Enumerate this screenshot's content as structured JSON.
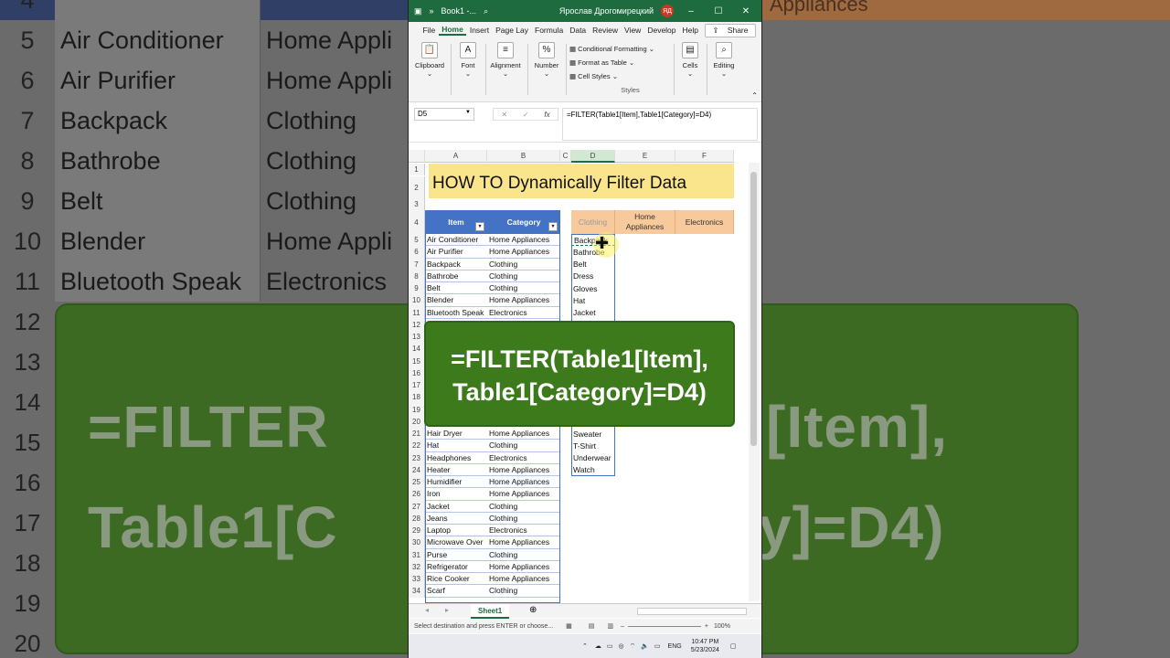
{
  "background": {
    "left_rows": [
      {
        "n": "4",
        "a": "",
        "b": ""
      },
      {
        "n": "5",
        "a": "Air Conditioner",
        "b": "Home Appli"
      },
      {
        "n": "6",
        "a": "Air Purifier",
        "b": "Home Appli"
      },
      {
        "n": "7",
        "a": "Backpack",
        "b": "Clothing"
      },
      {
        "n": "8",
        "a": "Bathrobe",
        "b": "Clothing"
      },
      {
        "n": "9",
        "a": "Belt",
        "b": "Clothing"
      },
      {
        "n": "10",
        "a": "Blender",
        "b": "Home Appli"
      },
      {
        "n": "11",
        "a": "Bluetooth Speak",
        "b": "Electronics"
      }
    ],
    "left_nums": [
      "12",
      "13",
      "14",
      "15",
      "16",
      "17",
      "18",
      "19",
      "20"
    ],
    "right_header_text": "Appliances",
    "left_big_text_1": "=FILTER",
    "left_big_text_2": "Table1[C",
    "right_big_text_1": "[Item],",
    "right_big_text_2": "y]=D4)"
  },
  "titlebar": {
    "autosave": "»",
    "filename": "Book1 -...",
    "user": "Ярослав Дрогомирецкий",
    "initials": "ЯД"
  },
  "menu": [
    "File",
    "Home",
    "Insert",
    "Page Lay",
    "Formula",
    "Data",
    "Review",
    "View",
    "Develop",
    "Help"
  ],
  "share_label": "Share",
  "ribbon": {
    "clipboard": "Clipboard",
    "font": "Font",
    "alignment": "Alignment",
    "number": "Number",
    "cond_format": "Conditional Formatting",
    "format_table": "Format as Table",
    "cell_styles": "Cell Styles",
    "styles": "Styles",
    "cells": "Cells",
    "editing": "Editing"
  },
  "formula_bar": {
    "name_box": "D5",
    "formula": "=FILTER(Table1[Item],Table1[Category]=D4)"
  },
  "columns": [
    "A",
    "B",
    "C",
    "D",
    "E",
    "F"
  ],
  "banner_title": "HOW TO Dynamically Filter Data",
  "table": {
    "headers": [
      "Item",
      "Category"
    ],
    "rows": [
      [
        "Air Conditioner",
        "Home Appliances"
      ],
      [
        "Air Purifier",
        "Home Appliances"
      ],
      [
        "Backpack",
        "Clothing"
      ],
      [
        "Bathrobe",
        "Clothing"
      ],
      [
        "Belt",
        "Clothing"
      ],
      [
        "Blender",
        "Home Appliances"
      ],
      [
        "Bluetooth Speak",
        "Electronics"
      ],
      [
        "Hair Dryer",
        "Home Appliances"
      ],
      [
        "Hat",
        "Clothing"
      ],
      [
        "Headphones",
        "Electronics"
      ],
      [
        "Heater",
        "Home Appliances"
      ],
      [
        "Humidifier",
        "Home Appliances"
      ],
      [
        "Iron",
        "Home Appliances"
      ],
      [
        "Jacket",
        "Clothing"
      ],
      [
        "Jeans",
        "Clothing"
      ],
      [
        "Laptop",
        "Electronics"
      ],
      [
        "Microwave Over",
        "Home Appliances"
      ],
      [
        "Purse",
        "Clothing"
      ],
      [
        "Refrigerator",
        "Home Appliances"
      ],
      [
        "Rice Cooker",
        "Home Appliances"
      ],
      [
        "Scarf",
        "Clothing"
      ]
    ]
  },
  "output_headers": [
    "Clothing",
    "Home Appliances",
    "Electronics"
  ],
  "filtered_top": [
    "Backpack",
    "Bathrobe",
    "Belt",
    "Dress",
    "Gloves",
    "Hat",
    "Jacket"
  ],
  "filtered_bottom": [
    "Sweater",
    "T-Shirt",
    "Underwear",
    "Watch"
  ],
  "callout": {
    "line1": "=FILTER(Table1[Item],",
    "line2": "Table1[Category]=D4)"
  },
  "sheet_tab": "Sheet1",
  "status": {
    "text": "Select destination and press ENTER or choose...",
    "zoom": "100%"
  },
  "taskbar": {
    "lang": "ENG",
    "time": "10:47 PM",
    "date": "5/23/2024"
  },
  "colors": {
    "excel_green": "#1d6b3f",
    "table_blue": "#4472c4",
    "orange_header": "#f8c99b",
    "banner_yellow": "#fbe58c",
    "callout_green": "#3c7a1c"
  }
}
